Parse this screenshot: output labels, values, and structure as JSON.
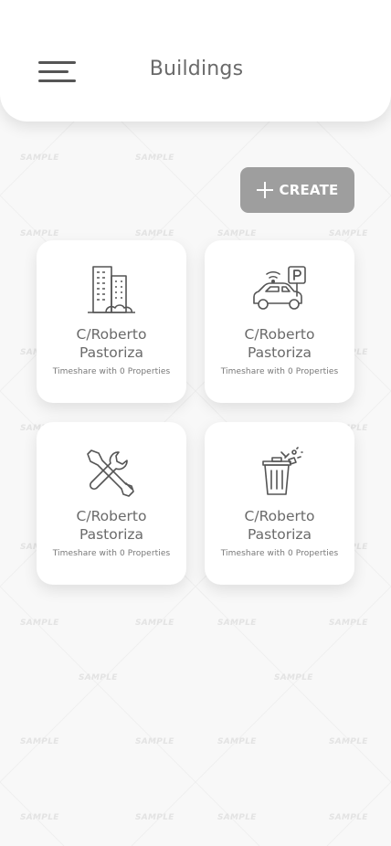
{
  "header": {
    "title": "Buildings",
    "menu_icon": "hamburger-menu-icon"
  },
  "toolbar": {
    "create_label": "CREATE",
    "create_icon": "plus-icon"
  },
  "watermark": "SAMPLE",
  "cards": [
    {
      "name": "C/Roberto Pastoriza",
      "subtitle": "Timeshare with 0 Properties",
      "icon": "buildings-icon"
    },
    {
      "name": "C/Roberto Pastoriza",
      "subtitle": "Timeshare with 0 Properties",
      "icon": "car-parking-icon"
    },
    {
      "name": "C/Roberto Pastoriza",
      "subtitle": "Timeshare with 0 Properties",
      "icon": "tools-icon"
    },
    {
      "name": "C/Roberto Pastoriza",
      "subtitle": "Timeshare with 0 Properties",
      "icon": "trash-bin-icon"
    }
  ],
  "colors": {
    "background": "#f8f8f8",
    "button": "#9e9e9e",
    "text": "#6a6a6a"
  }
}
